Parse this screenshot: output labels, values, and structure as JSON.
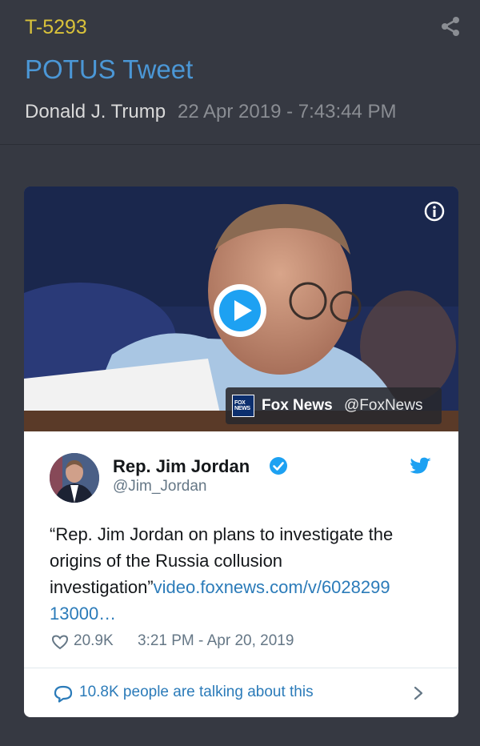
{
  "header": {
    "item_id": "T-5293",
    "title": "POTUS Tweet",
    "author": "Donald J. Trump",
    "timestamp": "22 Apr 2019 - 7:43:44 PM"
  },
  "embed": {
    "video": {
      "source_name": "Fox News",
      "source_handle": "@FoxNews",
      "logo_text": "FOX NEWS"
    },
    "tweet": {
      "display_name": "Rep. Jim Jordan",
      "handle": "@Jim_Jordan",
      "text_line_1": "“Rep. Jim Jordan on plans to investigate the",
      "text_line_2": "origins of the Russia collusion",
      "text_line_3": "investigation”",
      "link_part_1": "video.foxnews.com/v/6028299",
      "link_part_2": "13000…",
      "likes": "20.9K",
      "time": "3:21 PM - Apr 20, 2019",
      "talking": "10.8K people are talking about this"
    }
  },
  "colors": {
    "background": "#363942",
    "item_id": "#d9c23a",
    "title": "#4b97d6",
    "link": "#2b7bb9",
    "verified": "#1da1f2"
  },
  "icons": [
    "share-icon",
    "info-icon",
    "play-icon",
    "verified-icon",
    "twitter-bird-icon",
    "heart-icon",
    "speech-bubble-icon",
    "chevron-right-icon"
  ]
}
